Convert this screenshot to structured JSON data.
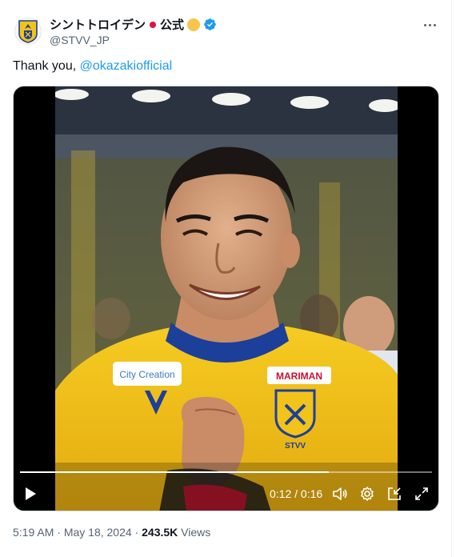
{
  "account": {
    "display_name": "シントトロイデン",
    "official_label": "公式",
    "handle": "@STVV_JP"
  },
  "tweet": {
    "text_prefix": "Thank you, ",
    "mention": "@okazakiofficial"
  },
  "video": {
    "current_time": "0:12",
    "separator": " / ",
    "duration": "0:16",
    "progress": 0.75,
    "jersey_sponsor": "City Creation",
    "jersey_chest": "MARIMAN",
    "crest_text": "STVV"
  },
  "meta": {
    "time": "5:19 AM",
    "dot1": " · ",
    "date": "May 18, 2024",
    "dot2": " · ",
    "views_count": "243.5K",
    "views_label": " Views"
  },
  "colors": {
    "link": "#1d9bf0",
    "verified": "#1d9bf0",
    "jersey_yellow": "#f2c318",
    "jersey_blue": "#1c3f9a"
  },
  "icons": [
    "club-crest-icon",
    "flag-icon",
    "sun-icon",
    "verified-icon",
    "more-icon",
    "play-icon",
    "volume-icon",
    "settings-icon",
    "pip-icon",
    "fullscreen-icon"
  ]
}
